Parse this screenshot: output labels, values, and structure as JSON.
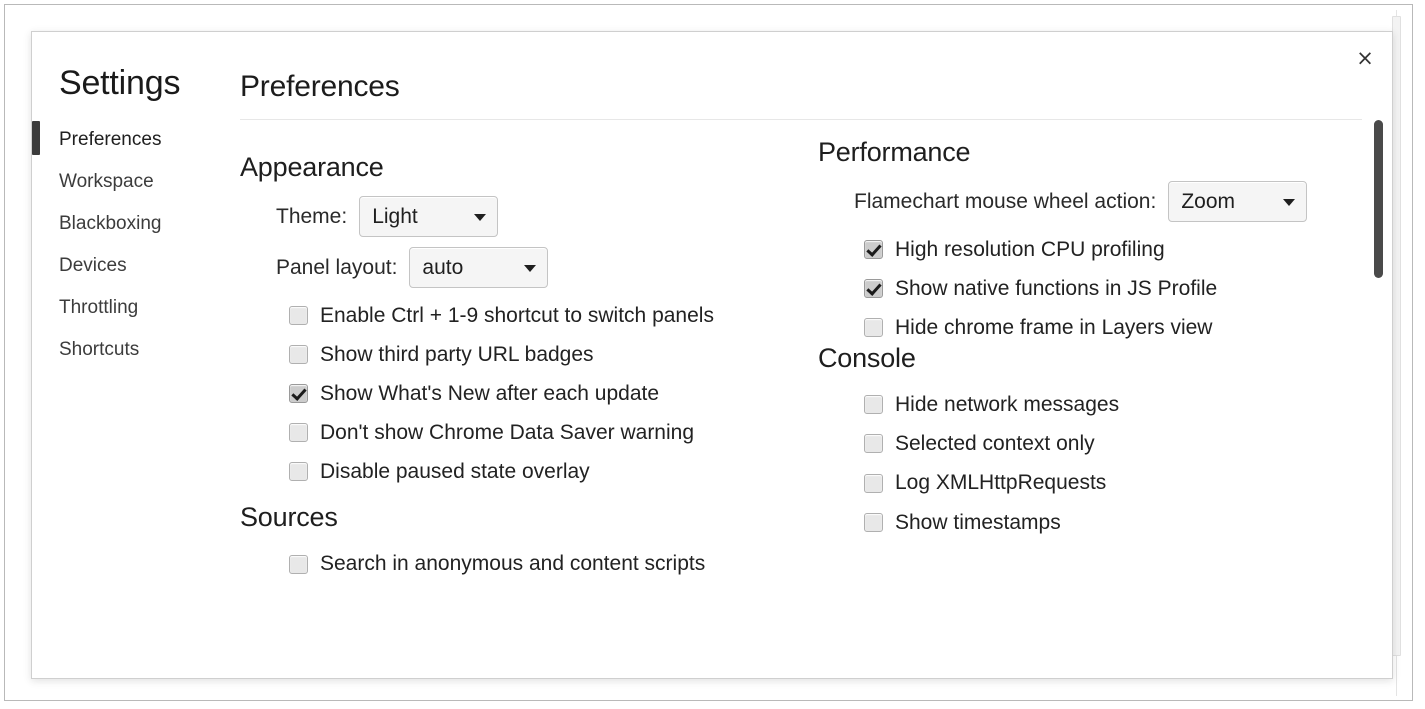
{
  "dialog": {
    "close_label": "×",
    "sidebar": {
      "title": "Settings",
      "items": [
        {
          "label": "Preferences",
          "selected": true
        },
        {
          "label": "Workspace",
          "selected": false
        },
        {
          "label": "Blackboxing",
          "selected": false
        },
        {
          "label": "Devices",
          "selected": false
        },
        {
          "label": "Throttling",
          "selected": false
        },
        {
          "label": "Shortcuts",
          "selected": false
        }
      ]
    },
    "content": {
      "title": "Preferences",
      "left_column": [
        {
          "section": "Appearance",
          "selects": [
            {
              "label": "Theme:",
              "value": "Light"
            },
            {
              "label": "Panel layout:",
              "value": "auto"
            }
          ],
          "checkboxes": [
            {
              "label": "Enable Ctrl + 1-9 shortcut to switch panels",
              "checked": false
            },
            {
              "label": "Show third party URL badges",
              "checked": false
            },
            {
              "label": "Show What's New after each update",
              "checked": true
            },
            {
              "label": "Don't show Chrome Data Saver warning",
              "checked": false
            },
            {
              "label": "Disable paused state overlay",
              "checked": false
            }
          ]
        },
        {
          "section": "Sources",
          "selects": [],
          "checkboxes": [
            {
              "label": "Search in anonymous and content scripts",
              "checked": false
            }
          ]
        }
      ],
      "right_column": [
        {
          "section": "Performance",
          "selects": [
            {
              "label": "Flamechart mouse wheel action:",
              "value": "Zoom"
            }
          ],
          "checkboxes": [
            {
              "label": "High resolution CPU profiling",
              "checked": true
            },
            {
              "label": "Show native functions in JS Profile",
              "checked": true
            },
            {
              "label": "Hide chrome frame in Layers view",
              "checked": false
            }
          ]
        },
        {
          "section": "Console",
          "selects": [],
          "checkboxes": [
            {
              "label": "Hide network messages",
              "checked": false
            },
            {
              "label": "Selected context only",
              "checked": false
            },
            {
              "label": "Log XMLHttpRequests",
              "checked": false
            },
            {
              "label": "Show timestamps",
              "checked": false
            }
          ]
        }
      ]
    }
  },
  "colors": {
    "dialog_border": "#cfcfcf",
    "selected_bar": "#3b3b3b",
    "text": "#222222",
    "scroll_thumb": "#4a4a4a"
  }
}
